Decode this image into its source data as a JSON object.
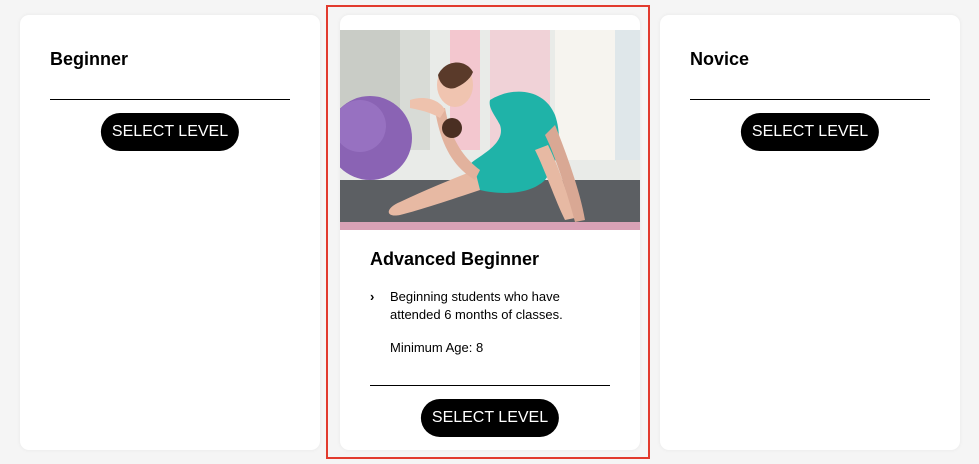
{
  "levels": [
    {
      "title": "Beginner",
      "button_label": "SELECT LEVEL"
    },
    {
      "title": "Advanced Beginner",
      "description": "Beginning students who have attended 6 months of classes.",
      "min_age": "Minimum Age: 8",
      "button_label": "SELECT LEVEL"
    },
    {
      "title": "Novice",
      "button_label": "SELECT LEVEL"
    }
  ],
  "icons": {
    "bullet": "chevron-right-icon"
  },
  "colors": {
    "button_bg": "#000000",
    "button_text": "#ffffff",
    "highlight_border": "#e23b2e",
    "card_bg": "#ffffff",
    "page_bg": "#f5f5f5"
  }
}
